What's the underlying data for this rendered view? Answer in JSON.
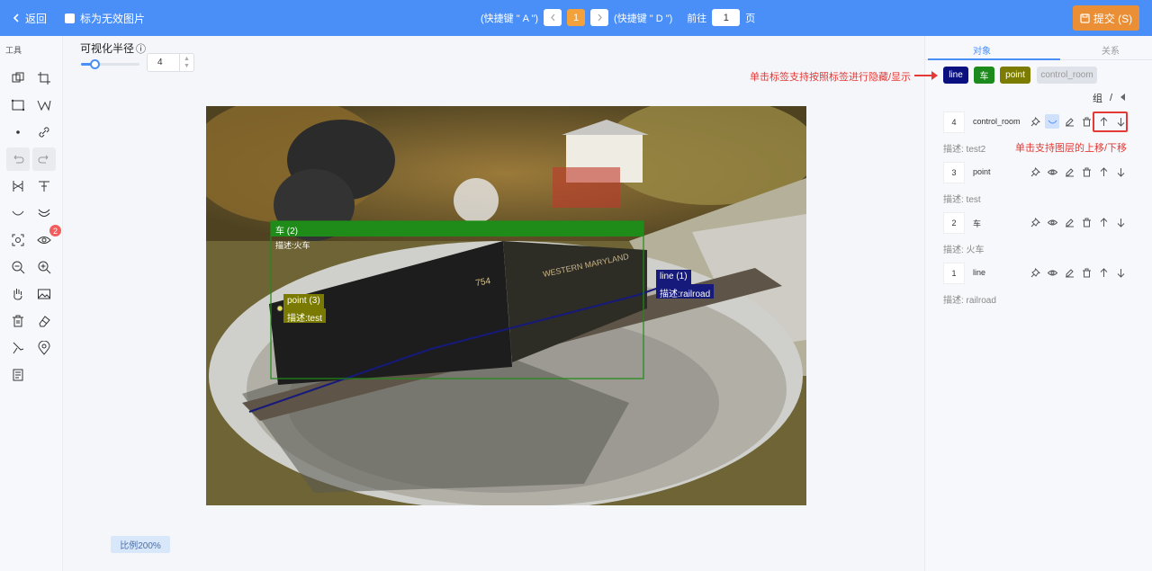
{
  "header": {
    "back_label": "返回",
    "invalid_label": "标为无效图片",
    "prev_shortcut": "(快捷键 \" A \")",
    "next_shortcut": "(快捷键 \" D \")",
    "current_page": "1",
    "goto_label": "前往",
    "goto_value": "1",
    "page_unit": "页",
    "submit_label": "提交 (S)"
  },
  "toolbar": {
    "title": "工具",
    "visibility_badge": "2",
    "icons": [
      "copy-rect-icon",
      "crop-icon",
      "rectangle-icon",
      "polyline-icon",
      "point-icon",
      "link-icon",
      "undo-icon",
      "redo-icon",
      "split-icon",
      "text-icon",
      "curve-icon",
      "double-curve-icon",
      "focus-icon",
      "eye-icon",
      "zoom-out-icon",
      "zoom-in-icon",
      "hand-icon",
      "image-icon",
      "delete-icon",
      "eraser-icon",
      "brush-icon",
      "location-icon",
      "notes-icon"
    ]
  },
  "radius": {
    "label": "可视化半径",
    "info_icon": "ⓘ",
    "value": "4",
    "slider_percent": 15
  },
  "canvas": {
    "scale_label": "比例200%",
    "annotations": {
      "car": {
        "title": "车 (2)",
        "desc": "描述:火车",
        "color": "#1f8b18"
      },
      "line": {
        "title": "line (1)",
        "desc": "描述:railroad",
        "color": "#161a7a"
      },
      "point": {
        "title": "point (3)",
        "desc": "描述:test",
        "color": "#7a7a00"
      }
    }
  },
  "panel": {
    "tab_objects": "对象",
    "tab_relations": "关系",
    "chips": [
      {
        "label": "line",
        "color": "#0b1080"
      },
      {
        "label": "车",
        "color": "#1c8a1c"
      },
      {
        "label": "point",
        "color": "#7c7c00"
      },
      {
        "label": "control_room",
        "color": "#dfe2e8"
      }
    ],
    "group_label": "组",
    "group_sep": "/",
    "items": [
      {
        "index": "4",
        "name": "control_room",
        "desc": "描述: test2"
      },
      {
        "index": "3",
        "name": "point",
        "desc": "描述: test"
      },
      {
        "index": "2",
        "name": "车",
        "desc": "描述: 火车"
      },
      {
        "index": "1",
        "name": "line",
        "desc": "描述: railroad"
      }
    ]
  },
  "callouts": {
    "chips_hint": "单击标签支持按照标签进行隐藏/显示",
    "layer_hint": "单击支持图层的上移/下移"
  }
}
